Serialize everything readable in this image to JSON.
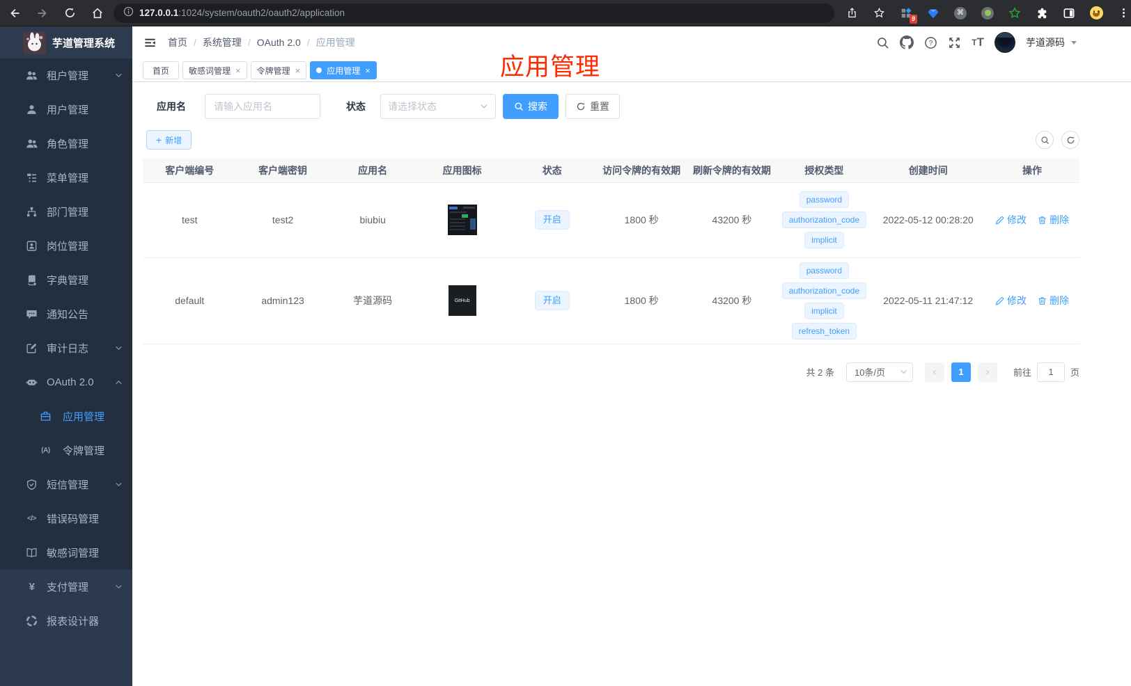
{
  "browser": {
    "url_host": "127.0.0.1",
    "url_path": ":1024/system/oauth2/oauth2/application",
    "extension_badge": "9"
  },
  "sidebar": {
    "title": "芋道管理系统",
    "items": [
      "租户管理",
      "用户管理",
      "角色管理",
      "菜单管理",
      "部门管理",
      "岗位管理",
      "字典管理",
      "通知公告",
      "审计日志",
      "OAuth 2.0",
      "短信管理",
      "错误码管理",
      "敏感词管理",
      "支付管理",
      "报表设计器"
    ],
    "oauth_children": [
      "应用管理",
      "令牌管理"
    ],
    "token_icon_text": "(A)",
    "errcode_icon_text": "</>",
    "pay_icon_text": "¥"
  },
  "navbar": {
    "breadcrumbs": [
      "首页",
      "系统管理",
      "OAuth 2.0",
      "应用管理"
    ],
    "username": "芋道源码"
  },
  "tabs": [
    "首页",
    "敏感词管理",
    "令牌管理",
    "应用管理"
  ],
  "annotation": {
    "text": "应用管理"
  },
  "filters": {
    "name_label": "应用名",
    "name_placeholder": "请输入应用名",
    "status_label": "状态",
    "status_placeholder": "请选择状态",
    "search_label": "搜索",
    "reset_label": "重置"
  },
  "toolbar": {
    "add_label": "新增"
  },
  "table": {
    "columns": [
      "客户端编号",
      "客户端密钥",
      "应用名",
      "应用图标",
      "状态",
      "访问令牌的有效期",
      "刷新令牌的有效期",
      "授权类型",
      "创建时间",
      "操作"
    ],
    "ops": {
      "edit": "修改",
      "delete": "删除"
    },
    "rows": [
      {
        "client_id": "test",
        "client_secret": "test2",
        "app_name": "biubiu",
        "status": "开启",
        "access_token_validity": "1800 秒",
        "refresh_token_validity": "43200 秒",
        "grant_types": [
          "password",
          "authorization_code",
          "implicit"
        ],
        "create_time": "2022-05-12 00:28:20"
      },
      {
        "client_id": "default",
        "client_secret": "admin123",
        "app_name": "芋道源码",
        "status": "开启",
        "access_token_validity": "1800 秒",
        "refresh_token_validity": "43200 秒",
        "grant_types": [
          "password",
          "authorization_code",
          "implicit",
          "refresh_token"
        ],
        "create_time": "2022-05-11 21:47:12",
        "icon_text": "GitHub"
      }
    ]
  },
  "pagination": {
    "total": "共 2 条",
    "page_size": "10条/页",
    "current_page": "1",
    "goto_label": "前往",
    "goto_value": "1",
    "page_unit": "页"
  },
  "colors": {
    "primary": "#409eff",
    "annotation": "#ff2a00"
  }
}
